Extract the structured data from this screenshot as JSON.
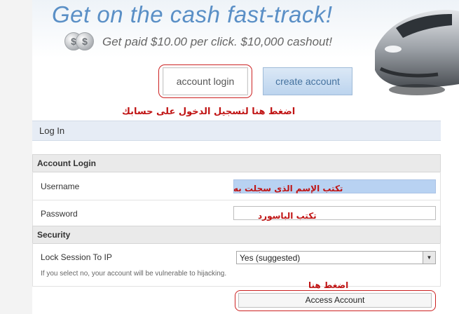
{
  "banner": {
    "headline": "Get on the cash fast-track!",
    "subline": "Get paid $10.00 per click. $10,000 cashout!",
    "coin_symbol": "$",
    "login_button": "account login",
    "create_button": "create account"
  },
  "annotations": {
    "click_login": "اضغط هنا لتسجيل الدخول على حسابك",
    "type_username": "تكتب الإسم الذى سجلت به",
    "type_password": "تكتب الباسورد",
    "click_here": "اضغط هنا"
  },
  "login": {
    "header": "Log In",
    "account_section": "Account Login",
    "username_label": "Username",
    "password_label": "Password",
    "security_section": "Security",
    "lock_label": "Lock Session To IP",
    "lock_value": "Yes (suggested)",
    "warning": "If you select no, your account will be vulnerable to hijacking.",
    "access_button": "Access Account"
  },
  "colors": {
    "annotation_red": "#c01414",
    "headline_blue": "#5a8fc6",
    "username_highlight": "#b8d2f2"
  }
}
